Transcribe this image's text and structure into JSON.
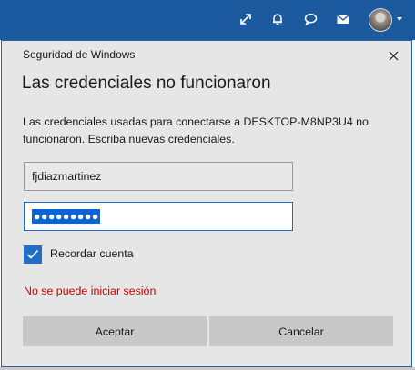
{
  "topbar": {
    "icons": [
      "expand-icon",
      "bell-icon",
      "chat-icon",
      "mail-icon"
    ],
    "color": "#1b5a9e"
  },
  "dialog": {
    "window_title": "Seguridad de Windows",
    "heading": "Las credenciales no funcionaron",
    "message": "Las credenciales usadas para conectarse a DESKTOP-M8NP3U4 no funcionaron. Escriba nuevas credenciales.",
    "username_value": "fjdiazmartinez",
    "password_mask": "●●●●●●●●●",
    "remember_label": "Recordar cuenta",
    "remember_checked": true,
    "error_text": "No se puede iniciar sesión",
    "accept_label": "Aceptar",
    "cancel_label": "Cancelar",
    "accent_color": "#1f6fc8",
    "error_color": "#c50000"
  }
}
